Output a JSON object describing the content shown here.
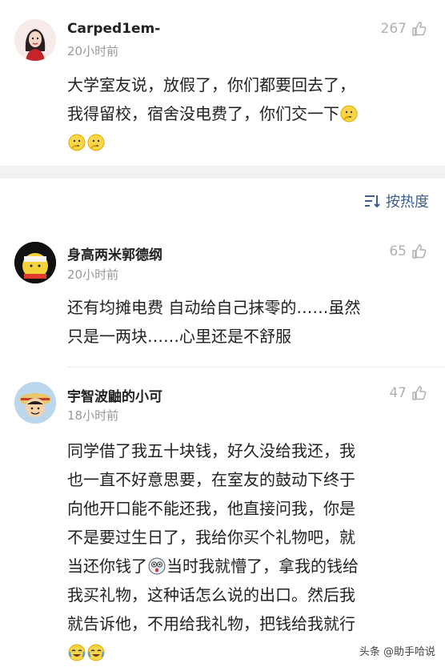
{
  "comments": [
    {
      "username": "Carped1em-",
      "time": "20小时前",
      "likes": "267",
      "lines": [
        "大学室友说，放假了，你们都要回去了，",
        "我得留校，宿舍没电费了，你们交一下"
      ]
    },
    {
      "username": "身高两米郭德纲",
      "time": "20小时前",
      "likes": "65",
      "lines": [
        "还有均摊电费 自动给自己抹零的……虽然",
        "只是一两块……心里还是不舒服"
      ]
    },
    {
      "username": "宇智波鼬的小可",
      "time": "18小时前",
      "likes": "47",
      "lines": [
        "同学借了我五十块钱，好久没给我还，我",
        "也一直不好意思要，在室友的鼓动下终于",
        "向他开口能不能还我，他直接问我，你是",
        "不是要过生日了，我给你买个礼物吧，就",
        "当还你钱了",
        "当时我就懵了，拿我的钱给",
        "我买礼物，这种话怎么说的出口。然后我",
        "就告诉他，不用给我礼物，把钱给我就行"
      ]
    }
  ],
  "sort": {
    "label": "按热度"
  },
  "watermark": "头条 @助手哈说"
}
